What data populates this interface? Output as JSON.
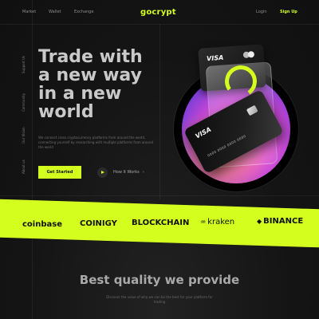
{
  "nav": {
    "links": [
      "Market",
      "Wallet",
      "Exchange"
    ],
    "brand": "gocrypt",
    "login": "Login",
    "signup": "Sign Up"
  },
  "side_nav": [
    "Support Us",
    "Community",
    "Our Vision",
    "About us"
  ],
  "hero": {
    "title_lines": [
      "Trade with",
      "a new way",
      "in a new",
      "world"
    ],
    "description": "We connect cross cryptocurrency platforms from around the world, connecting yourself by researching with multiple platforms from around the world",
    "cta_label": "Get Started",
    "secondary_label": "How It Works",
    "secondary_arrow": "›"
  },
  "cards": {
    "back_brand": "VISA",
    "front_brand": "VISA",
    "front_number": "0000 0000 0000 0000"
  },
  "partners": [
    "coinbase",
    "COINIGY",
    "BLOCKCHAIN",
    "kraken",
    "BINANCE"
  ],
  "quality": {
    "title": "Best quality we provide",
    "description": "Discover the value of why we can be the best for your platform for trading"
  },
  "colors": {
    "accent": "#d4ff1e",
    "background": "#151515",
    "orb": "#b944d6"
  }
}
